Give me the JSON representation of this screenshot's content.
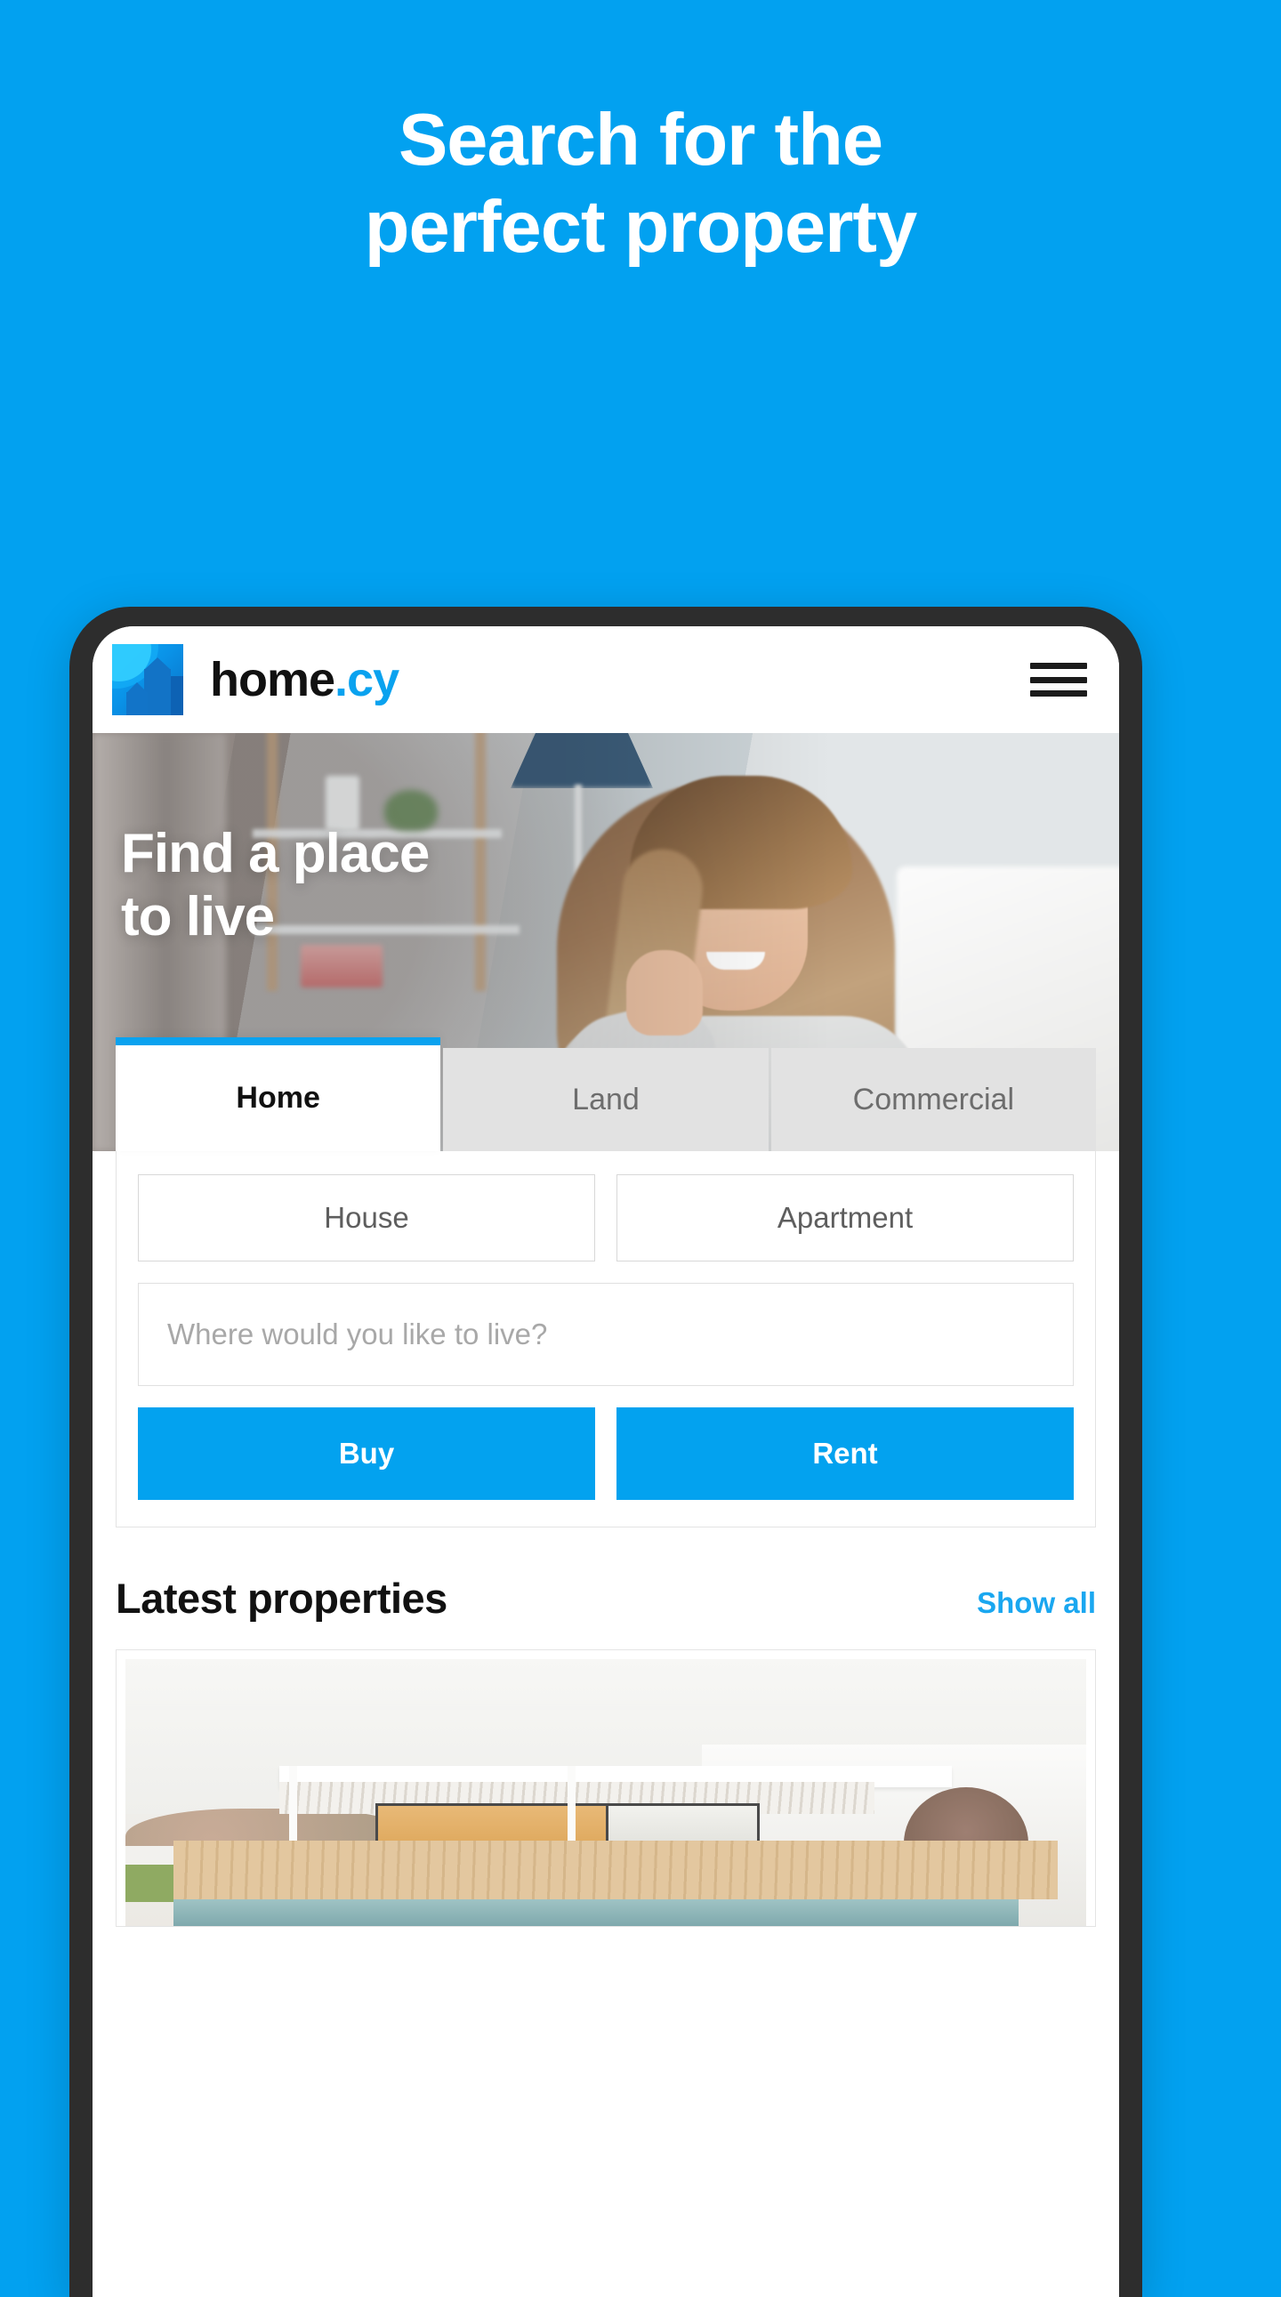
{
  "promo": {
    "headline_line1": "Search for the",
    "headline_line2": "perfect property",
    "background_color": "#02A1F0"
  },
  "app": {
    "header": {
      "logo_name": "home",
      "logo_tld": ".cy",
      "logo_icon": "building-house-mark-icon",
      "menu_icon": "hamburger-menu-icon"
    },
    "hero": {
      "title_line1": "Find a place",
      "title_line2": "to live",
      "photo_alt": "smiling-woman-in-living-room"
    },
    "search": {
      "tabs": [
        {
          "label": "Home",
          "active": true
        },
        {
          "label": "Land",
          "active": false
        },
        {
          "label": "Commercial",
          "active": false
        }
      ],
      "property_types": [
        {
          "label": "House"
        },
        {
          "label": "Apartment"
        }
      ],
      "location_placeholder": "Where would you like to live?",
      "location_value": "",
      "actions": [
        {
          "label": "Buy"
        },
        {
          "label": "Rent"
        }
      ]
    },
    "latest": {
      "title": "Latest properties",
      "show_all_label": "Show all",
      "cards": [
        {
          "photo_alt": "modern-white-villa-with-pool-and-pergola"
        }
      ]
    },
    "colors": {
      "accent": "#03A2EF",
      "link": "#1AA7F0",
      "tab_inactive_bg": "#E2E2E2",
      "text_primary": "#111111",
      "text_muted": "#6D6D6D",
      "placeholder": "#A8A8A8"
    }
  }
}
